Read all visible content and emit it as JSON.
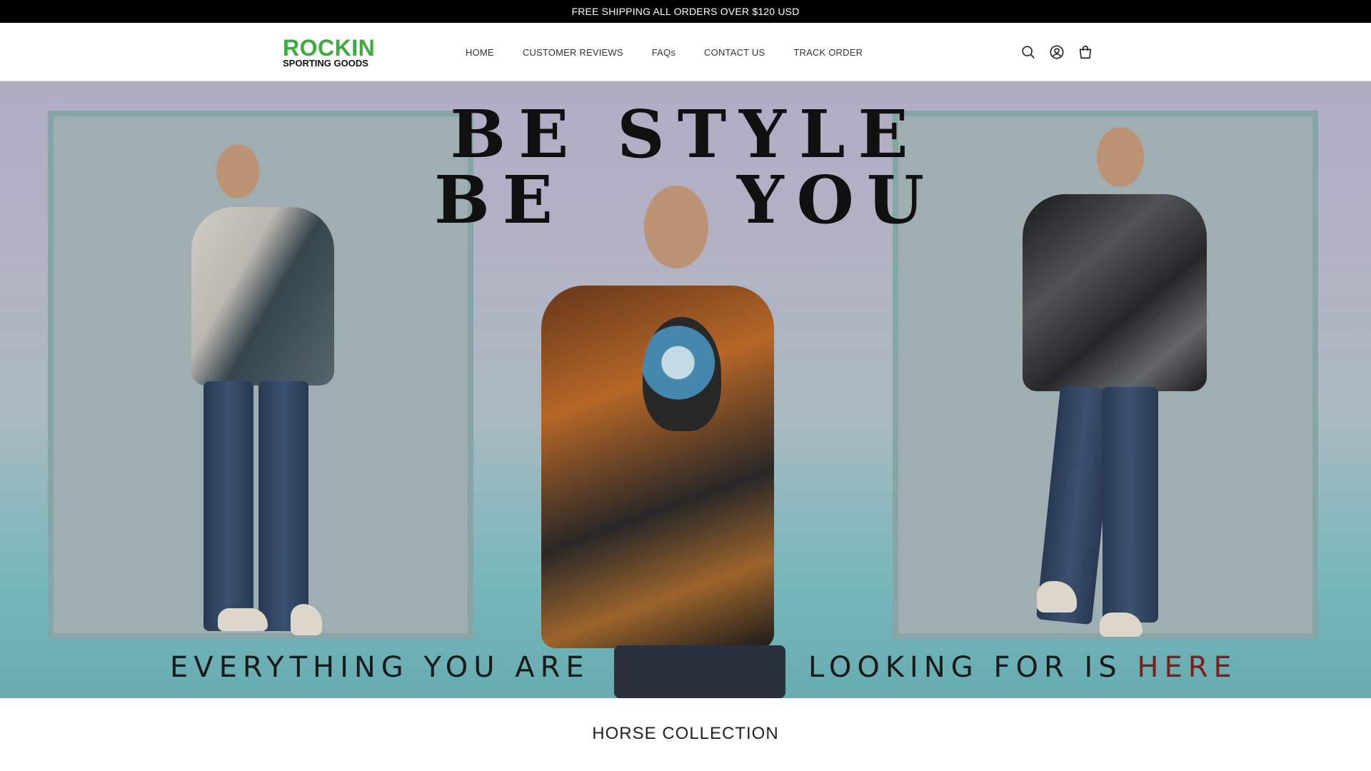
{
  "announcement": {
    "text": "FREE SHIPPING ALL ORDERS OVER $120 USD"
  },
  "brand": {
    "name": "ROCKIN",
    "tagline": "SPORTING GOODS",
    "color": "#3cab3c"
  },
  "nav": {
    "items": [
      {
        "label": "HOME"
      },
      {
        "label": "CUSTOMER REVIEWS"
      },
      {
        "label": "FAQs"
      },
      {
        "label": "CONTACT US"
      },
      {
        "label": "TRACK ORDER"
      }
    ]
  },
  "header_icons": [
    "search-icon",
    "account-icon",
    "cart-icon"
  ],
  "hero": {
    "headline_line1": "BE STYLE",
    "headline_line2_a": "BE",
    "headline_line2_b": "YOU",
    "tagline_left": "EVERYTHING YOU ARE",
    "tagline_right": "LOOKING FOR IS",
    "tagline_highlight": "HERE",
    "highlight_color": "#8a1f1f"
  },
  "section": {
    "title": "HORSE COLLECTION"
  }
}
